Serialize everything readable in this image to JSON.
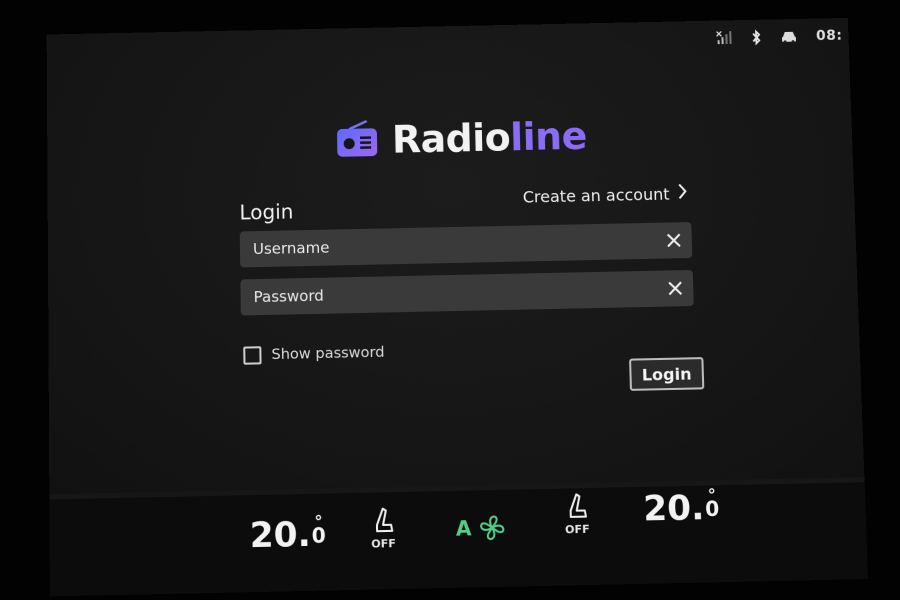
{
  "status_bar": {
    "signal_icon": "signal-icon",
    "bluetooth_icon": "bluetooth-icon",
    "car_icon": "car-icon",
    "time": "08:"
  },
  "app": {
    "logo_icon": "radio-icon",
    "name_part1": "Radio",
    "name_part2": "line",
    "accent_color": "#8b6cf6"
  },
  "login": {
    "title": "Login",
    "create_account": "Create an account",
    "username_label": "Username",
    "password_label": "Password",
    "show_password": "Show password",
    "show_password_checked": false,
    "login_button": "Login"
  },
  "climate": {
    "left_temp": "20.",
    "left_temp_sub": "0",
    "left_seat_label": "OFF",
    "fan_label": "A",
    "fan_color": "#4fd08a",
    "right_seat_label": "OFF",
    "right_temp": "20.",
    "right_temp_sub": "0"
  }
}
